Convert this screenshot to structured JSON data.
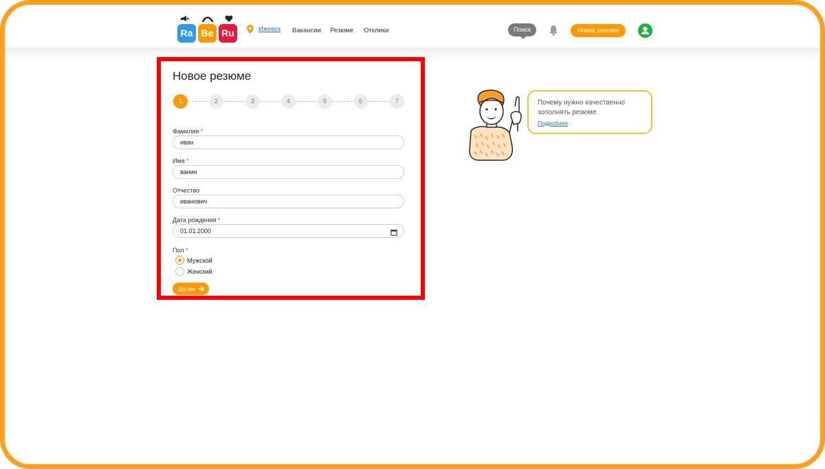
{
  "header": {
    "logo": [
      "Ra",
      "Be",
      "Ru"
    ],
    "city": "Ижевск",
    "nav": [
      "Вакансии",
      "Резюме",
      "Отклики"
    ],
    "search_label": "Поиск",
    "new_resume_label": "Новое резюме"
  },
  "form": {
    "title": "Новое резюме",
    "steps": [
      "1",
      "2",
      "3",
      "4",
      "5",
      "6",
      "7"
    ],
    "active_step": 1,
    "required_mark": "*",
    "fields": {
      "last_name": {
        "label": "Фамилия",
        "value": "иван"
      },
      "first_name": {
        "label": "Имя",
        "value": "ванин"
      },
      "middle_name": {
        "label": "Отчество",
        "value": "иванович"
      },
      "birth_date": {
        "label": "Дата рождения",
        "value": "01.01.2000"
      }
    },
    "gender": {
      "label": "Пол",
      "options": [
        "Мужской",
        "Женский"
      ],
      "selected": "Мужской"
    },
    "next_label": "Далее"
  },
  "hint": {
    "text": "Почему нужно качественно зополнять резюме",
    "link": "Подробнее"
  },
  "colors": {
    "accent": "#ff9900",
    "frame": "#ff9f1a",
    "highlight": "#ff0000",
    "link": "#2d74c8",
    "avatar": "#19b33a",
    "logo_ra": "#2f9be6",
    "logo_be": "#ff9900",
    "logo_ru": "#e8183c"
  }
}
